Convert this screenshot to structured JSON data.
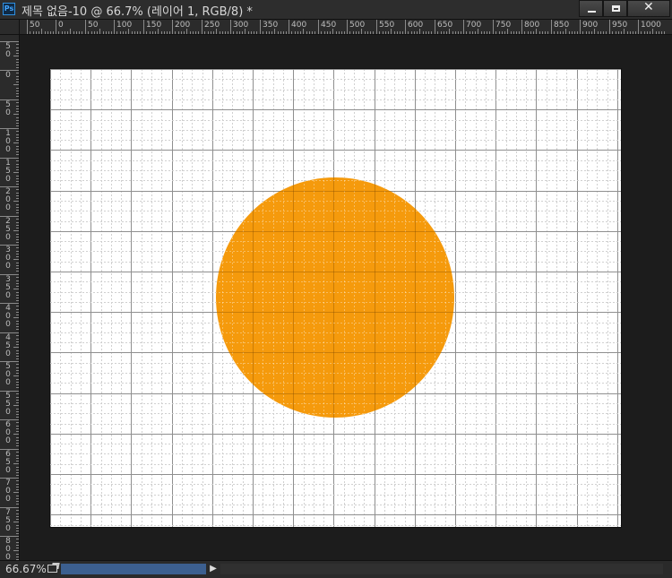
{
  "app": {
    "logo_text": "Ps"
  },
  "document": {
    "title": "제목 없음-10 @ 66.7% (레이어 1, RGB/8) *"
  },
  "window_controls": {
    "minimize": "minimize",
    "maximize": "maximize",
    "close": "close"
  },
  "rulers": {
    "horizontal_labels": [
      "50",
      "0",
      "50",
      "100",
      "150",
      "200",
      "250",
      "300",
      "350",
      "400",
      "450",
      "500",
      "550",
      "600",
      "650",
      "700",
      "750",
      "800",
      "850",
      "900",
      "950",
      "1000"
    ],
    "vertical_labels": [
      "50",
      "0",
      "50",
      "100",
      "150",
      "200",
      "250",
      "300",
      "350",
      "400",
      "450",
      "500",
      "550",
      "600",
      "650",
      "700",
      "750",
      "800"
    ]
  },
  "canvas": {
    "background_color": "#ffffff",
    "grid_major_color": "#8f8f8f",
    "grid_minor_color": "#d0d0d0",
    "shape_color": "#f59a0c"
  },
  "status": {
    "zoom": "66.67%"
  },
  "icons": {
    "share": "share-icon",
    "scroll_right": "chevron-right-icon"
  }
}
